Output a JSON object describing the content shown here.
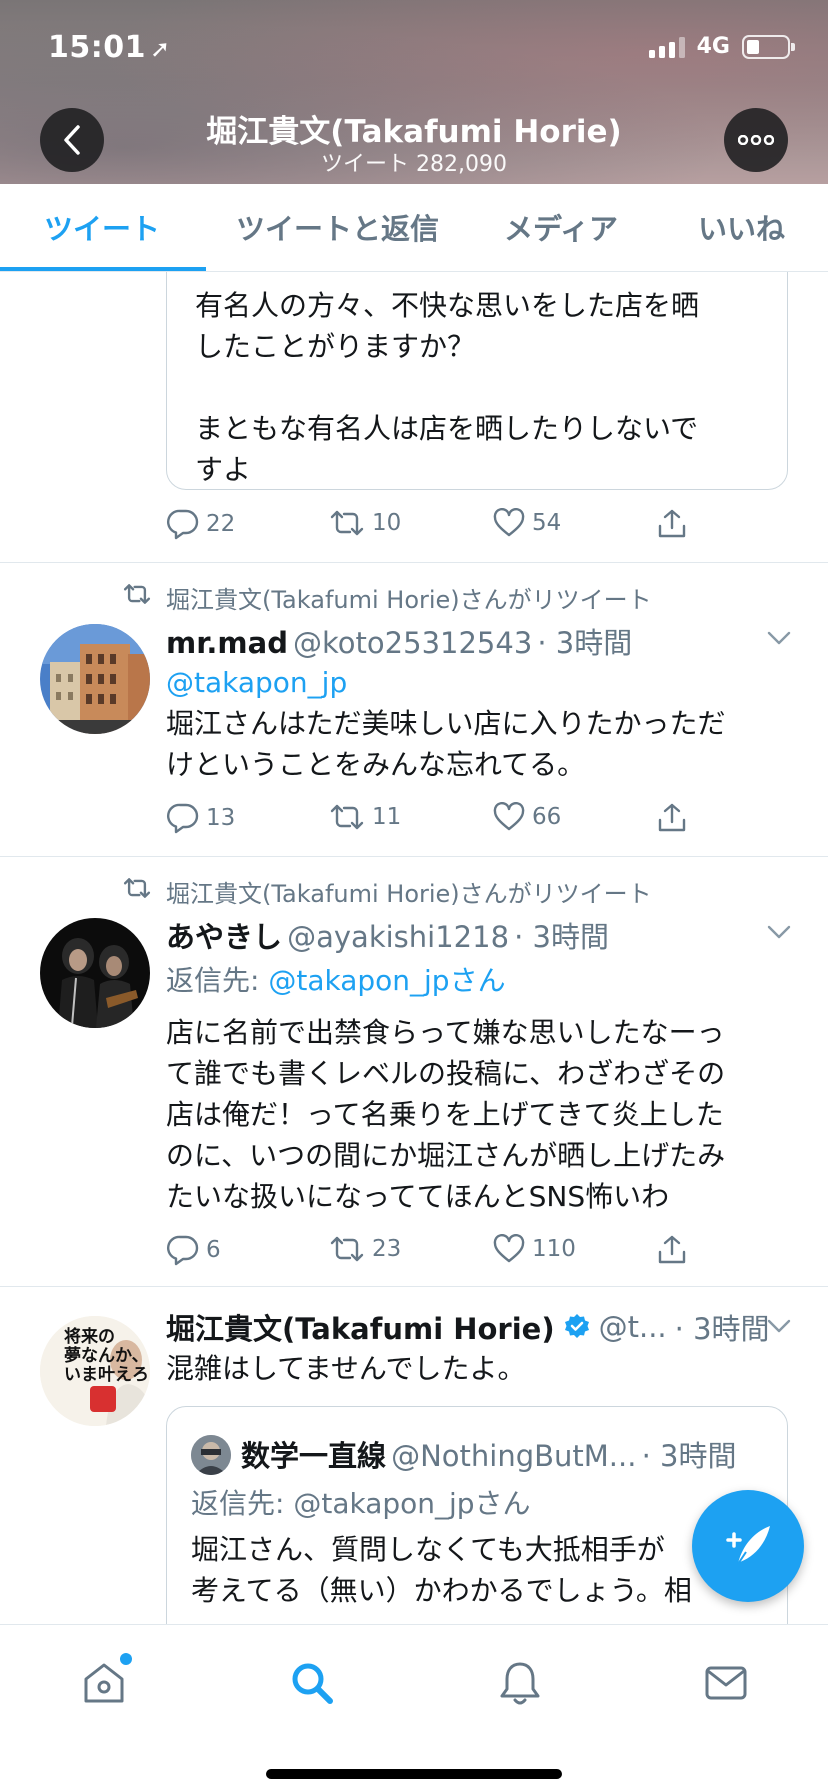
{
  "status_bar": {
    "time": "15:01",
    "network": "4G"
  },
  "header": {
    "profile_name": "堀江貴文(Takafumi Horie)",
    "tweet_count": "ツイート 282,090"
  },
  "tabs": [
    {
      "label": "ツイート",
      "active": true
    },
    {
      "label": "ツイートと返信",
      "active": false
    },
    {
      "label": "メディア",
      "active": false
    },
    {
      "label": "いいね",
      "active": false
    }
  ],
  "tweet1": {
    "quote_lines": [
      "有名人の方々、不快な思いをした店を晒",
      "したことがりますか？",
      "まともな有名人は店を晒したりしないで",
      "すよ"
    ],
    "replies": "22",
    "retweets": "10",
    "likes": "54"
  },
  "tweet2": {
    "retweeted_by": "堀江貴文(Takafumi Horie)さんがリツイート",
    "name": "mr.mad",
    "handle": "@koto25312543",
    "time": "· 3時間",
    "mention": "@takapon_jp",
    "lines": [
      "堀江さんはただ美味しい店に入りたかっただ",
      "けということをみんな忘れてる。"
    ],
    "replies": "13",
    "retweets": "11",
    "likes": "66"
  },
  "tweet3": {
    "retweeted_by": "堀江貴文(Takafumi Horie)さんがリツイート",
    "name": "あやきし",
    "handle": "@ayakishi1218",
    "time": "· 3時間",
    "reply_prefix": "返信先: ",
    "reply_to": "@takapon_jpさん",
    "lines": [
      "店に名前で出禁食らって嫌な思いしたなーっ",
      "て誰でも書くレベルの投稿に、わざわざその",
      "店は俺だ！って名乗りを上げてきて炎上した",
      "のに、いつの間にか堀江さんが晒し上げたみ",
      "たいな扱いになっててほんとSNS怖いわ"
    ],
    "replies": "6",
    "retweets": "23",
    "likes": "110"
  },
  "tweet4": {
    "name": "堀江貴文(Takafumi Horie)",
    "handle": "@t...",
    "time": "· 3時間",
    "text": "混雑はしてませんでしたよ。",
    "avatar_text": [
      "将来の",
      "夢なんか、",
      "いま叶えろ"
    ],
    "quote": {
      "name": "数学一直線",
      "handle": "@NothingButM...",
      "time": "· 3時間",
      "reply_to": "返信先: @takapon_jpさん",
      "lines": [
        "堀江さん、質問しなくても大抵相手が",
        "考えてる（無い）かわかるでしょう。相"
      ]
    }
  },
  "colors": {
    "accent": "#1da1f2",
    "gray": "#657786",
    "text": "#14171a",
    "border": "#e1e8ed"
  },
  "icons": {
    "back": "chevron-left-icon",
    "more": "more-dots-icon",
    "reply": "reply-icon",
    "retweet": "retweet-icon",
    "like": "heart-icon",
    "share": "share-icon",
    "verified": "verified-badge-icon",
    "compose": "compose-feather-icon",
    "home": "home-icon",
    "search": "search-icon",
    "notifications": "bell-icon",
    "messages": "mail-icon"
  }
}
